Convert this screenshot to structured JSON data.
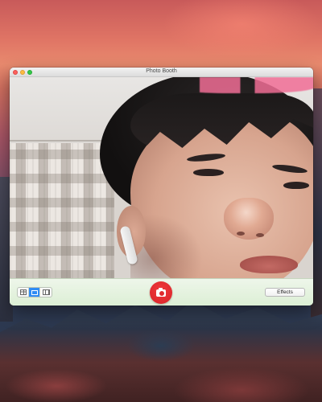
{
  "window": {
    "title": "Photo Booth",
    "controls": [
      "close-icon",
      "minimize-icon",
      "zoom-icon"
    ]
  },
  "toolbar": {
    "view_modes": [
      {
        "name": "grid-view-icon",
        "active": false
      },
      {
        "name": "single-photo-icon",
        "active": true
      },
      {
        "name": "filmstrip-icon",
        "active": false
      }
    ],
    "shutter_icon": "camera-icon",
    "shutter_color": "#e02a2e",
    "effects_label": "Effects"
  },
  "colors": {
    "toolbar_bg": "#dcefd5",
    "active_view": "#2f8cf4"
  }
}
